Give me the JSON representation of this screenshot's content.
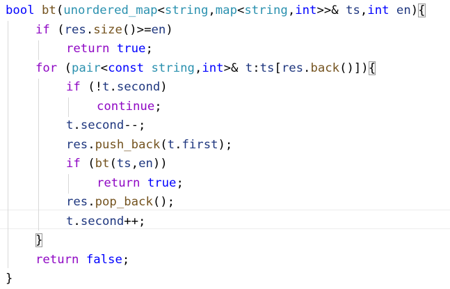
{
  "editor": {
    "lines": [
      {
        "tokens": [
          {
            "t": "bool",
            "c": "kw"
          },
          {
            "t": " ",
            "c": "pun"
          },
          {
            "t": "bt",
            "c": "fn"
          },
          {
            "t": "(",
            "c": "pun"
          },
          {
            "t": "unordered_map",
            "c": "ty"
          },
          {
            "t": "<",
            "c": "pun"
          },
          {
            "t": "string",
            "c": "ty"
          },
          {
            "t": ",",
            "c": "pun"
          },
          {
            "t": "map",
            "c": "ty"
          },
          {
            "t": "<",
            "c": "pun"
          },
          {
            "t": "string",
            "c": "ty"
          },
          {
            "t": ",",
            "c": "pun"
          },
          {
            "t": "int",
            "c": "kw"
          },
          {
            "t": ">>& ",
            "c": "pun"
          },
          {
            "t": "ts",
            "c": "var"
          },
          {
            "t": ",",
            "c": "pun"
          },
          {
            "t": "int",
            "c": "kw"
          },
          {
            "t": " ",
            "c": "pun"
          },
          {
            "t": "en",
            "c": "var"
          },
          {
            "t": ")",
            "c": "pun"
          },
          {
            "t": "{",
            "c": "pun br"
          }
        ]
      },
      {
        "tokens": [
          {
            "t": "if",
            "c": "ctl"
          },
          {
            "t": " (",
            "c": "pun"
          },
          {
            "t": "res",
            "c": "var"
          },
          {
            "t": ".",
            "c": "pun"
          },
          {
            "t": "size",
            "c": "fn"
          },
          {
            "t": "()>=",
            "c": "pun"
          },
          {
            "t": "en",
            "c": "var"
          },
          {
            "t": ")",
            "c": "pun"
          }
        ]
      },
      {
        "tokens": [
          {
            "t": "return",
            "c": "ctl"
          },
          {
            "t": " ",
            "c": "pun"
          },
          {
            "t": "true",
            "c": "kw"
          },
          {
            "t": ";",
            "c": "pun"
          }
        ]
      },
      {
        "tokens": [
          {
            "t": "for",
            "c": "ctl"
          },
          {
            "t": " (",
            "c": "pun"
          },
          {
            "t": "pair",
            "c": "ty"
          },
          {
            "t": "<",
            "c": "pun"
          },
          {
            "t": "const",
            "c": "kw"
          },
          {
            "t": " ",
            "c": "pun"
          },
          {
            "t": "string",
            "c": "ty"
          },
          {
            "t": ",",
            "c": "pun"
          },
          {
            "t": "int",
            "c": "kw"
          },
          {
            "t": ">& ",
            "c": "pun"
          },
          {
            "t": "t",
            "c": "var"
          },
          {
            "t": ":",
            "c": "pun"
          },
          {
            "t": "ts",
            "c": "var"
          },
          {
            "t": "[",
            "c": "pun"
          },
          {
            "t": "res",
            "c": "var"
          },
          {
            "t": ".",
            "c": "pun"
          },
          {
            "t": "back",
            "c": "fn"
          },
          {
            "t": "()])",
            "c": "pun"
          },
          {
            "t": "{",
            "c": "pun br"
          }
        ]
      },
      {
        "tokens": [
          {
            "t": "if",
            "c": "ctl"
          },
          {
            "t": " (!",
            "c": "pun"
          },
          {
            "t": "t",
            "c": "var"
          },
          {
            "t": ".",
            "c": "pun"
          },
          {
            "t": "second",
            "c": "var"
          },
          {
            "t": ")",
            "c": "pun"
          }
        ]
      },
      {
        "tokens": [
          {
            "t": "continue",
            "c": "ctl"
          },
          {
            "t": ";",
            "c": "pun"
          }
        ]
      },
      {
        "tokens": [
          {
            "t": "t",
            "c": "var"
          },
          {
            "t": ".",
            "c": "pun"
          },
          {
            "t": "second",
            "c": "var"
          },
          {
            "t": "--;",
            "c": "pun"
          }
        ]
      },
      {
        "tokens": [
          {
            "t": "res",
            "c": "var"
          },
          {
            "t": ".",
            "c": "pun"
          },
          {
            "t": "push_back",
            "c": "fn"
          },
          {
            "t": "(",
            "c": "pun"
          },
          {
            "t": "t",
            "c": "var"
          },
          {
            "t": ".",
            "c": "pun"
          },
          {
            "t": "first",
            "c": "var"
          },
          {
            "t": ");",
            "c": "pun"
          }
        ]
      },
      {
        "tokens": [
          {
            "t": "if",
            "c": "ctl"
          },
          {
            "t": " (",
            "c": "pun"
          },
          {
            "t": "bt",
            "c": "fn"
          },
          {
            "t": "(",
            "c": "pun"
          },
          {
            "t": "ts",
            "c": "var"
          },
          {
            "t": ",",
            "c": "pun"
          },
          {
            "t": "en",
            "c": "var"
          },
          {
            "t": "))",
            "c": "pun"
          }
        ]
      },
      {
        "tokens": [
          {
            "t": "return",
            "c": "ctl"
          },
          {
            "t": " ",
            "c": "pun"
          },
          {
            "t": "true",
            "c": "kw"
          },
          {
            "t": ";",
            "c": "pun"
          }
        ]
      },
      {
        "tokens": [
          {
            "t": "res",
            "c": "var"
          },
          {
            "t": ".",
            "c": "pun"
          },
          {
            "t": "pop_back",
            "c": "fn"
          },
          {
            "t": "();",
            "c": "pun"
          }
        ]
      },
      {
        "tokens": [
          {
            "t": "t",
            "c": "var"
          },
          {
            "t": ".",
            "c": "pun"
          },
          {
            "t": "second",
            "c": "var"
          },
          {
            "t": "++;",
            "c": "pun"
          }
        ]
      },
      {
        "tokens": [
          {
            "t": "}",
            "c": "pun br"
          }
        ]
      },
      {
        "tokens": [
          {
            "t": "return",
            "c": "ctl"
          },
          {
            "t": " ",
            "c": "pun"
          },
          {
            "t": "false",
            "c": "kw"
          },
          {
            "t": ";",
            "c": "pun"
          }
        ]
      },
      {
        "tokens": [
          {
            "t": "}",
            "c": "pun"
          }
        ]
      }
    ]
  }
}
